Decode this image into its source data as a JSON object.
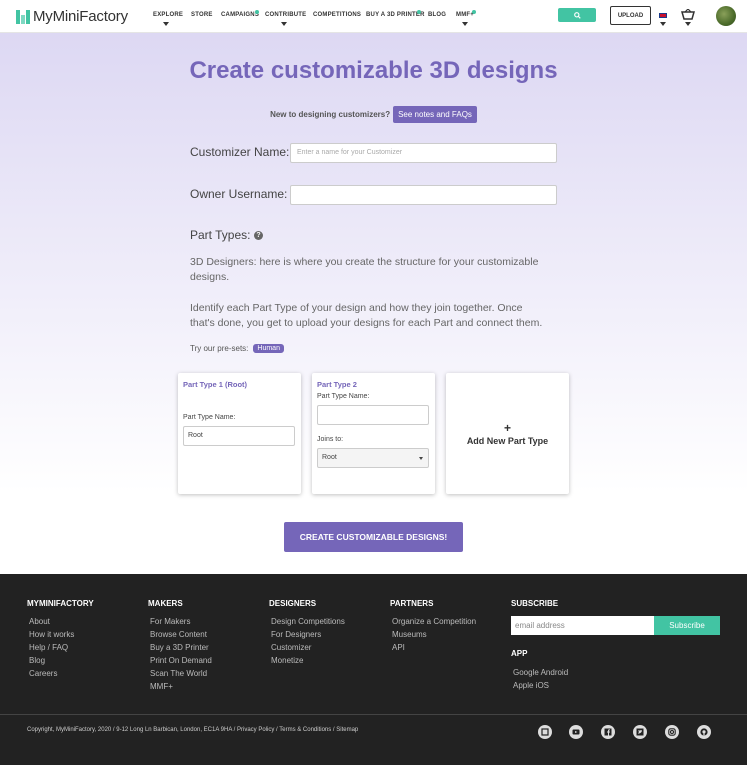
{
  "nav": {
    "logo_text": "MyMiniFactory",
    "items": [
      "EXPLORE",
      "STORE",
      "CAMPAIGNS",
      "CONTRIBUTE",
      "COMPETITIONS",
      "BUY A 3D PRINTER",
      "BLOG",
      "MMF+"
    ],
    "upload_label": "UPLOAD",
    "accent_color": "#42c4a3"
  },
  "hero": {
    "title": "Create customizable 3D designs",
    "faq_text": "New to designing customizers?",
    "faq_button": "See notes and FAQs"
  },
  "form": {
    "customizer_name_label": "Customizer Name:",
    "customizer_name_placeholder": "Enter a name for your Customizer",
    "owner_username_label": "Owner Username:",
    "owner_username_value": "",
    "part_types_label": "Part Types:",
    "desc1": "3D Designers: here is where you create the structure for your customizable designs.",
    "desc2": "Identify each Part Type of your design and how they join together. Once that's done, you get to upload your designs for each Part and connect them.",
    "presets_label": "Try our pre-sets:",
    "preset_human": "Human"
  },
  "cards": {
    "card1_title": "Part Type 1 (Root)",
    "card1_name_label": "Part Type Name:",
    "card1_name_value": "Root",
    "card2_title": "Part Type 2",
    "card2_name_label": "Part Type Name:",
    "card2_joins_label": "Joins to:",
    "card2_joins_value": "Root",
    "add_plus": "+",
    "add_label": "Add New Part Type"
  },
  "create_button": "CREATE CUSTOMIZABLE DESIGNS!",
  "footer": {
    "col1": {
      "heading": "MYMINIFACTORY",
      "links": [
        "About",
        "How it works",
        "Help / FAQ",
        "Blog",
        "Careers"
      ]
    },
    "col2": {
      "heading": "MAKERS",
      "links": [
        "For Makers",
        "Browse Content",
        "Buy a 3D Printer",
        "Print On Demand",
        "Scan The World",
        "MMF+"
      ]
    },
    "col3": {
      "heading": "DESIGNERS",
      "links": [
        "Design Competitions",
        "For Designers",
        "Customizer",
        "Monetize"
      ]
    },
    "col4": {
      "heading": "PARTNERS",
      "links": [
        "Organize a Competition",
        "Museums",
        "API"
      ]
    },
    "subscribe": {
      "heading": "SUBSCRIBE",
      "placeholder": "email address",
      "button": "Subscribe"
    },
    "app": {
      "heading": "APP",
      "links": [
        "Google Android",
        "Apple iOS"
      ]
    },
    "copyright": "Copyright, MyMiniFactory, 2020 / 9-12 Long Ln Barbican, London, EC1A 9HA / Privacy Policy  / Terms & Conditions  / Sitemap",
    "social_icons": [
      "mmf-icon",
      "youtube-icon",
      "facebook-icon",
      "twitter-icon",
      "instagram-icon",
      "github-icon"
    ]
  }
}
